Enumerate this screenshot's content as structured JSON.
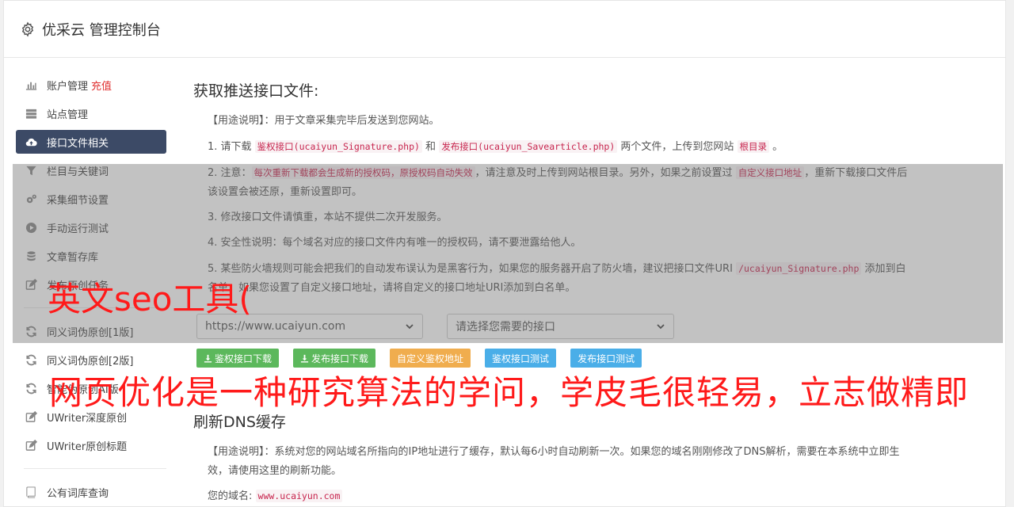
{
  "header": {
    "title": "优采云 管理控制台",
    "icon": "gear-icon"
  },
  "sidebar": {
    "group1": [
      {
        "label": "账户管理",
        "extra": "充值",
        "icon": "bar-chart-icon",
        "active": false
      },
      {
        "label": "站点管理",
        "icon": "server-icon",
        "active": false
      },
      {
        "label": "接口文件相关",
        "icon": "cloud-upload-icon",
        "active": true
      },
      {
        "label": "栏目与关键词",
        "icon": "filter-icon",
        "active": false
      },
      {
        "label": "采集细节设置",
        "icon": "gears-icon",
        "active": false
      },
      {
        "label": "手动运行测试",
        "icon": "play-icon",
        "active": false
      },
      {
        "label": "文章暂存库",
        "icon": "database-icon",
        "active": false
      },
      {
        "label": "发布原创任务",
        "icon": "edit-icon",
        "active": false
      }
    ],
    "group2": [
      {
        "label": "同义词伪原创[1版]",
        "icon": "refresh-icon"
      },
      {
        "label": "同义词伪原创[2版]",
        "icon": "refresh-icon"
      },
      {
        "label": "智能伪原创AI版",
        "icon": "refresh-icon"
      },
      {
        "label": "UWriter深度原创",
        "icon": "edit-icon"
      },
      {
        "label": "UWriter原创标题",
        "icon": "edit-icon"
      }
    ],
    "group3": [
      {
        "label": "公有词库查询",
        "icon": "book-icon"
      }
    ]
  },
  "section1": {
    "title": "获取推送接口文件:",
    "usage_label": "【用途说明】",
    "usage_text": "：用于文章采集完毕后发送到您网站。",
    "p1": {
      "prefix": "1. 请下载 ",
      "code1": "鉴权接口(ucaiyun_Signature.php)",
      "mid": " 和 ",
      "code2": "发布接口(ucaiyun_Savearticle.php)",
      "suffix": " 两个文件，上传到您网站 ",
      "code3": "根目录",
      "end": " 。"
    },
    "p2": {
      "prefix": "2. 注意：",
      "code1": "每次重新下载都会生成新的授权码，原授权码自动失效",
      "mid": "，请注意及时上传到网站根目录。另外，如果之前设置过 ",
      "code2": "自定义接口地址",
      "suffix": "，重新下载接口文件后该设置会被还原，重新设置即可。"
    },
    "p3": "3. 修改接口文件请慎重，本站不提供二次开发服务。",
    "p4": "4. 安全性说明：每个域名对应的接口文件内有唯一的授权码，请不要泄露给他人。",
    "p5": {
      "prefix": "5. 某些防火墙规则可能会把我们的自动发布误认为是黑客行为，如果您的服务器开启了防火墙，建议把接口文件URI ",
      "code1": "/ucaiyun_Signature.php",
      "suffix": " 添加到白名单，如果您设置了自定义接口地址，请将自定义的接口地址URI添加到白名单。"
    },
    "select_site": "https://www.ucaiyun.com",
    "select_api": "请选择您需要的接口",
    "buttons": {
      "dl_sig": "鉴权接口下载",
      "dl_pub": "发布接口下载",
      "custom": "自定义鉴权地址",
      "test_sig": "鉴权接口测试",
      "test_pub": "发布接口测试"
    }
  },
  "section2": {
    "title": "刷新DNS缓存",
    "usage_label": "【用途说明】",
    "usage_text": "：系统对您的网站域名所指向的IP地址进行了缓存，默认每6小时自动刷新一次。如果您的域名刚刚修改了DNS解析，需要在本系统中立即生效，请使用这里的刷新功能。",
    "domain_label": "您的域名:",
    "domain_value": "www.ucaiyun.com"
  },
  "watermark": {
    "line1": "英文seo工具(",
    "line2": "网页优化是一种研究算法的学问，学皮毛很轻易，立志做精即"
  },
  "colors": {
    "active_bg": "#3c4a66",
    "accent_red": "#e03131",
    "code_red": "#c7254e",
    "green": "#5cb85c",
    "orange": "#f0ad4e",
    "blue": "#4aaee8"
  }
}
